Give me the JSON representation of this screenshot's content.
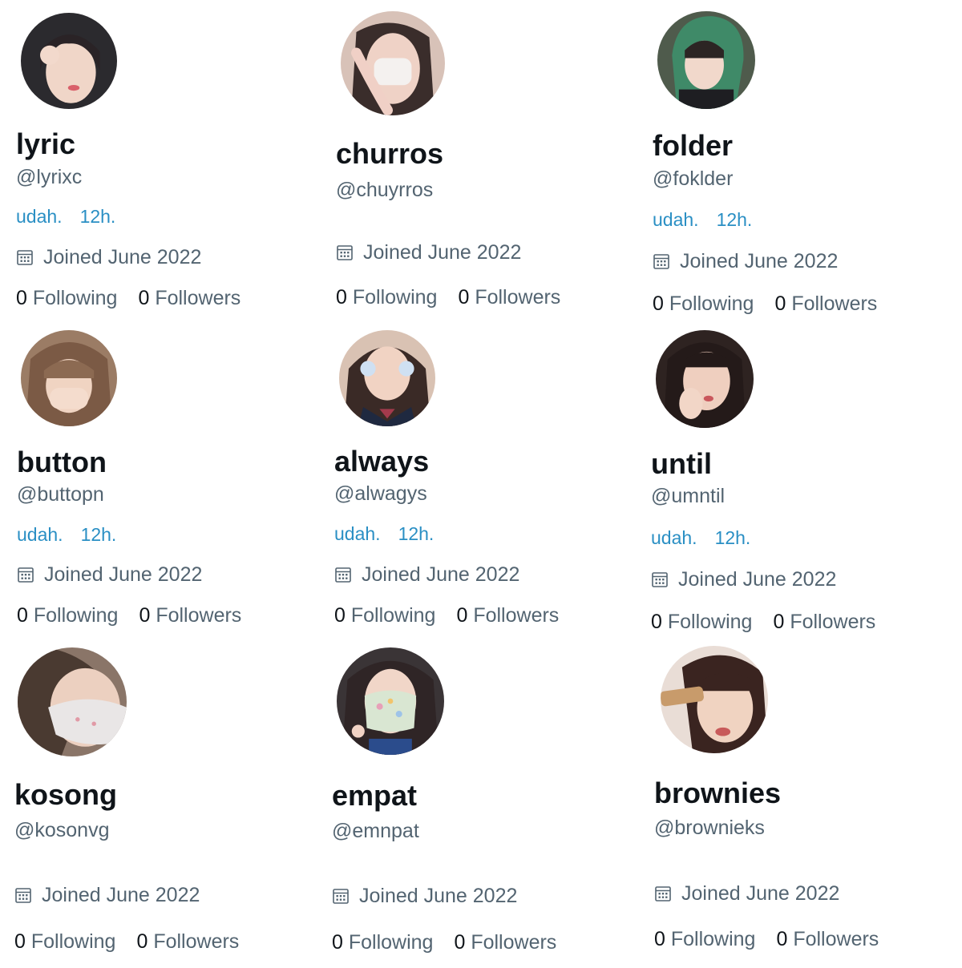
{
  "profiles": [
    {
      "name": "lyric",
      "handle": "@lyrixc",
      "bio": [
        "udah.",
        "12h."
      ],
      "joined": "Joined June 2022",
      "following_count": "0",
      "following_label": "Following",
      "followers_count": "0",
      "followers_label": "Followers",
      "avatar_bg": "#2b2a2e"
    },
    {
      "name": "churros",
      "handle": "@chuyrros",
      "bio": [],
      "joined": "Joined June 2022",
      "following_count": "0",
      "following_label": "Following",
      "followers_count": "0",
      "followers_label": "Followers",
      "avatar_bg": "#d8c2b8"
    },
    {
      "name": "folder",
      "handle": "@foklder",
      "bio": [
        "udah.",
        "12h."
      ],
      "joined": "Joined June 2022",
      "following_count": "0",
      "following_label": "Following",
      "followers_count": "0",
      "followers_label": "Followers",
      "avatar_bg": "#3f6b55"
    },
    {
      "name": "button",
      "handle": "@buttopn",
      "bio": [
        "udah.",
        "12h."
      ],
      "joined": "Joined June 2022",
      "following_count": "0",
      "following_label": "Following",
      "followers_count": "0",
      "followers_label": "Followers",
      "avatar_bg": "#8a6a55"
    },
    {
      "name": "always",
      "handle": "@alwagys",
      "bio": [
        "udah.",
        "12h."
      ],
      "joined": "Joined June 2022",
      "following_count": "0",
      "following_label": "Following",
      "followers_count": "0",
      "followers_label": "Followers",
      "avatar_bg": "#caa691"
    },
    {
      "name": "until",
      "handle": "@umntil",
      "bio": [
        "udah.",
        "12h."
      ],
      "joined": "Joined June 2022",
      "following_count": "0",
      "following_label": "Following",
      "followers_count": "0",
      "followers_label": "Followers",
      "avatar_bg": "#3a2b28"
    },
    {
      "name": "kosong",
      "handle": "@kosonvg",
      "bio": [],
      "joined": "Joined June 2022",
      "following_count": "0",
      "following_label": "Following",
      "followers_count": "0",
      "followers_label": "Followers",
      "avatar_bg": "#6e5a4e"
    },
    {
      "name": "empat",
      "handle": "@emnpat",
      "bio": [],
      "joined": "Joined June 2022",
      "following_count": "0",
      "following_label": "Following",
      "followers_count": "0",
      "followers_label": "Followers",
      "avatar_bg": "#3a3b4a"
    },
    {
      "name": "brownies",
      "handle": "@brownieks",
      "bio": [],
      "joined": "Joined June 2022",
      "following_count": "0",
      "following_label": "Following",
      "followers_count": "0",
      "followers_label": "Followers",
      "avatar_bg": "#b58a72"
    }
  ],
  "colors": {
    "name": "#0f1419",
    "secondary": "#536471",
    "bio_link": "#2a8fc4",
    "background": "#ffffff"
  }
}
